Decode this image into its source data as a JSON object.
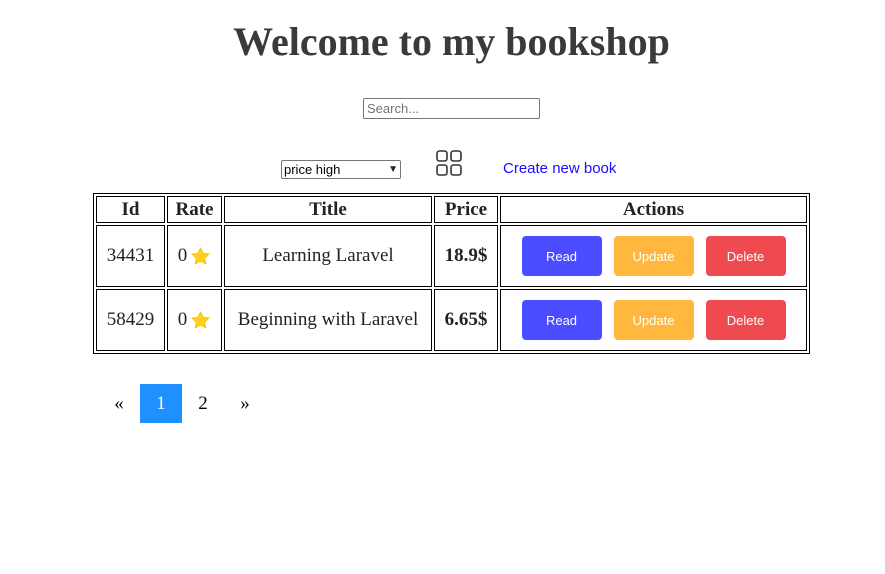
{
  "header": {
    "title": "Welcome to my bookshop"
  },
  "search": {
    "placeholder": "Search...",
    "value": ""
  },
  "toolbar": {
    "sort_selected": "price high",
    "grid_icon": "grid-view-icon",
    "create_link": "Create new book"
  },
  "table": {
    "headers": [
      "Id",
      "Rate",
      "Title",
      "Price",
      "Actions"
    ],
    "rows": [
      {
        "id": "34431",
        "rate": "0",
        "title": "Learning Laravel",
        "price": "18.9$"
      },
      {
        "id": "58429",
        "rate": "0",
        "title": "Beginning with Laravel",
        "price": "6.65$"
      }
    ],
    "actions": {
      "read": "Read",
      "update": "Update",
      "delete": "Delete"
    }
  },
  "pagination": {
    "prev": "«",
    "pages": [
      "1",
      "2"
    ],
    "next": "»",
    "active": "1"
  },
  "colors": {
    "read": "#4b4bff",
    "update": "#ffb83d",
    "delete": "#ef4a4f",
    "active_page": "#1e90ff",
    "link": "#1a0dff",
    "star": "#ffd21f"
  }
}
